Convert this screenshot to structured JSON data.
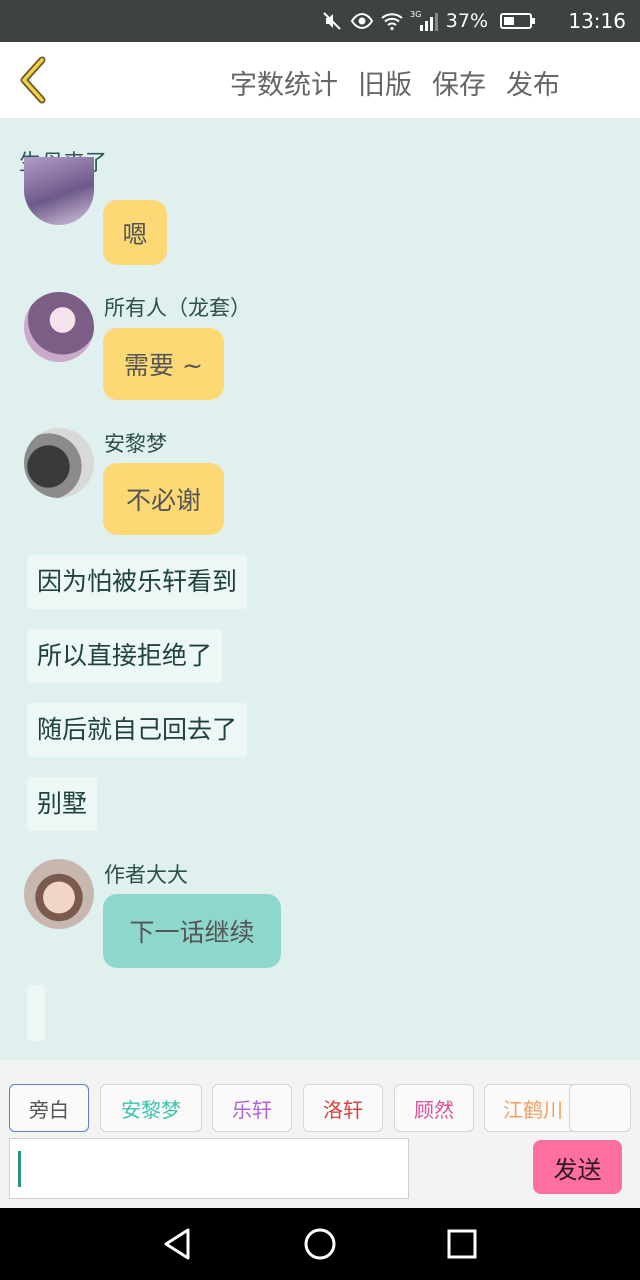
{
  "status_bar": {
    "signal_type": "3G",
    "battery_percent": "37%",
    "time": "13:16",
    "icons": [
      "mute-icon",
      "eye-icon",
      "wifi-icon",
      "cellular-signal-icon",
      "battery-icon"
    ]
  },
  "toolbar": {
    "back_icon": "chevron-left-icon",
    "word_count": "字数统计",
    "old_version": "旧版",
    "save": "保存",
    "publish": "发布"
  },
  "chat": {
    "story_title": "生母来了",
    "messages": [
      {
        "speaker": "",
        "text": "嗯",
        "style": "yellow"
      },
      {
        "speaker": "所有人（龙套）",
        "text": "需要 ~",
        "style": "yellow"
      },
      {
        "speaker": "安黎梦",
        "text": "不必谢",
        "style": "yellow"
      },
      {
        "speaker": "",
        "text": "因为怕被乐轩看到",
        "style": "narration"
      },
      {
        "speaker": "",
        "text": "所以直接拒绝了",
        "style": "narration"
      },
      {
        "speaker": "",
        "text": "随后就自己回去了",
        "style": "narration"
      },
      {
        "speaker": "",
        "text": "别墅",
        "style": "narration"
      },
      {
        "speaker": "作者大大",
        "text": "下一话继续",
        "style": "teal"
      }
    ]
  },
  "characters": [
    {
      "name": "旁白",
      "color": "#555555",
      "selected": true
    },
    {
      "name": "安黎梦",
      "color": "#3cc3b0",
      "selected": false
    },
    {
      "name": "乐轩",
      "color": "#b062d8",
      "selected": false
    },
    {
      "name": "洛轩",
      "color": "#d84242",
      "selected": false
    },
    {
      "name": "顾然",
      "color": "#e0509a",
      "selected": false
    },
    {
      "name": "江鹤川",
      "color": "#f0a060",
      "selected": false
    }
  ],
  "composer": {
    "input_value": "",
    "send_label": "发送",
    "send_color": "#ff6f9f"
  },
  "nav_bar": {
    "icons": [
      "back-triangle-icon",
      "home-circle-icon",
      "recents-square-icon"
    ]
  }
}
